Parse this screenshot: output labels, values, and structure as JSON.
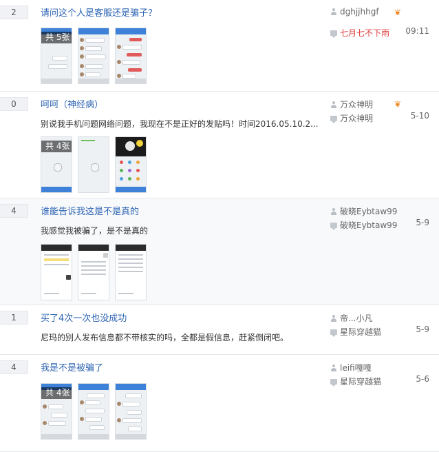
{
  "threads": [
    {
      "reply_count": "2",
      "title": "请问这个人是客服还是骗子？",
      "excerpt": "",
      "image_badge": "共 5张",
      "author": "dghjjhhgf",
      "last_reply_author": "七月七不下雨",
      "last_reply_time": "09:11",
      "has_level_icon": true
    },
    {
      "reply_count": "0",
      "title": "呵呵（神经病）",
      "excerpt": "别说我手机问题网络问题，我现在不是正好的发贴吗！时间2016.05.10.2...",
      "image_badge": "共 4张",
      "author": "万众神明",
      "last_reply_author": "万众神明",
      "last_reply_time": "5-10",
      "has_level_icon": true
    },
    {
      "reply_count": "4",
      "title": "谁能告诉我这是不是真的",
      "excerpt": "我感觉我被骗了，是不是真的",
      "image_badge": "",
      "author": "破晓Eybtaw99",
      "last_reply_author": "破晓Eybtaw99",
      "last_reply_time": "5-9",
      "has_level_icon": false
    },
    {
      "reply_count": "1",
      "title": "买了4次一次也没成功",
      "excerpt": "尼玛的别人发布信息都不带核实的吗，全都是假信息，赶紧倒闭吧。",
      "image_badge": "",
      "author": "帝...小凡",
      "last_reply_author": "星际穿越猫",
      "last_reply_time": "5-9",
      "has_level_icon": false
    },
    {
      "reply_count": "4",
      "title": "我是不是被骗了",
      "excerpt": "",
      "image_badge": "共 4张",
      "author": "leifi嘎嘎",
      "last_reply_author": "星际穿越猫",
      "last_reply_time": "5-6",
      "has_level_icon": false
    }
  ],
  "icons": {
    "author": "person-icon",
    "reply": "reply-bubble-icon",
    "level": "level-badge-icon"
  },
  "colors": {
    "title_link": "#2d64b3",
    "highlight_reply": "#e03b3b",
    "level_icon": "#f08a24"
  }
}
